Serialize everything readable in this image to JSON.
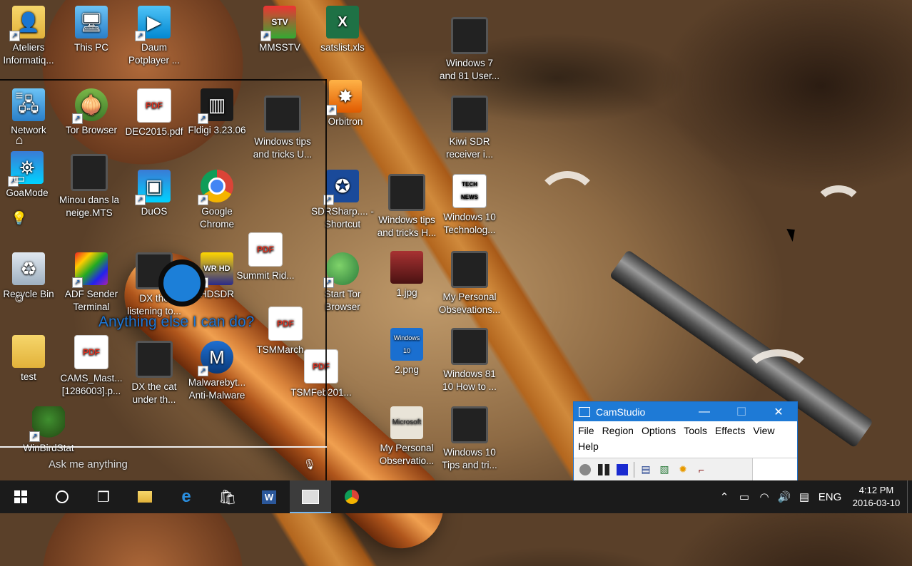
{
  "desktop": {
    "icons": [
      {
        "label": "Ateliers Informatiq...",
        "icon": "user-folder-icon"
      },
      {
        "label": "This PC",
        "icon": "computer-icon"
      },
      {
        "label": "Daum Potplayer ...",
        "icon": "play-icon"
      },
      {
        "label": "MMSSTV",
        "icon": "sstv-icon"
      },
      {
        "label": "satslist.xls",
        "icon": "excel-icon"
      },
      {
        "label": "Windows 7 and 81 User...",
        "icon": "video-icon"
      },
      {
        "label": "Network",
        "icon": "network-icon"
      },
      {
        "label": "Tor Browser",
        "icon": "tor-icon"
      },
      {
        "label": "DEC2015.pdf",
        "icon": "pdf-icon"
      },
      {
        "label": "Fldigi 3.23.06",
        "icon": "fldigi-icon"
      },
      {
        "label": "Windows tips and tricks U...",
        "icon": "video-icon"
      },
      {
        "label": "Orbitron",
        "icon": "orbitron-icon"
      },
      {
        "label": "Kiwi SDR receiver i...",
        "icon": "video-icon"
      },
      {
        "label": "GoaMode",
        "icon": "app-icon"
      },
      {
        "label": "Minou dans la neige.MTS",
        "icon": "video-icon"
      },
      {
        "label": "DuOS",
        "icon": "duos-icon"
      },
      {
        "label": "Google Chrome",
        "icon": "chrome-icon"
      },
      {
        "label": "SDRSharp.... - Shortcut",
        "icon": "sdrsharp-icon"
      },
      {
        "label": "Windows tips and tricks H...",
        "icon": "video-icon"
      },
      {
        "label": "Windows 10 Technolog...",
        "icon": "news-icon"
      },
      {
        "label": "Recycle Bin",
        "icon": "recycle-bin-icon"
      },
      {
        "label": "ADF Sender Terminal",
        "icon": "adf-icon"
      },
      {
        "label": "DX the listening to...",
        "icon": "video-icon"
      },
      {
        "label": "HDSDR",
        "icon": "hdsdr-icon"
      },
      {
        "label": "Summit Rid...",
        "icon": "pdf-icon"
      },
      {
        "label": "Start Tor Browser",
        "icon": "globe-icon"
      },
      {
        "label": "1.jpg",
        "icon": "image-icon"
      },
      {
        "label": "My Personal Obsevations...",
        "icon": "video-icon"
      },
      {
        "label": "test",
        "icon": "folder-icon"
      },
      {
        "label": "CAMS_Mast... [1286003].p...",
        "icon": "pdf-icon"
      },
      {
        "label": "DX the cat under th...",
        "icon": "video-icon"
      },
      {
        "label": "Malwarebyt... Anti-Malware",
        "icon": "malwarebytes-icon"
      },
      {
        "label": "TSMMarch....",
        "icon": "pdf-icon"
      },
      {
        "label": "TSMFeb201...",
        "icon": "pdf-icon"
      },
      {
        "label": "2.png",
        "icon": "image-icon"
      },
      {
        "label": "Windows 81 10 How to ...",
        "icon": "video-icon"
      },
      {
        "label": "WinBirdStat",
        "icon": "tree-icon"
      },
      {
        "label": "My Personal Observatio...",
        "icon": "video-icon"
      },
      {
        "label": "Windows 10 Tips and tri...",
        "icon": "video-icon"
      }
    ],
    "icon_badges": {
      "pdf": "PDF",
      "sstv": "STV",
      "excel": "X",
      "hdsdr": "WR HD",
      "tech": "TECH NEWS",
      "ms": "Microsoft",
      "win": "Windows 10"
    }
  },
  "cortana": {
    "prompt": "Anything else I can do?",
    "search_placeholder": "Ask me anything"
  },
  "camstudio": {
    "title": "CamStudio",
    "menu": [
      "File",
      "Region",
      "Options",
      "Tools",
      "Effects",
      "View",
      "Help"
    ],
    "controls": {
      "minimize": "—",
      "maximize": "☐",
      "close": "✕"
    }
  },
  "taskbar": {
    "pinned": [
      "start-icon",
      "cortana-icon",
      "task-view-icon",
      "file-explorer-icon",
      "edge-icon",
      "store-icon",
      "word-icon",
      "camstudio-icon",
      "chrome-icon"
    ],
    "language": "ENG",
    "time": "4:12 PM",
    "date": "2016-03-10"
  },
  "colors": {
    "accent": "#1e7ad6",
    "taskbar": "#1b1b1b",
    "cortana_text": "#1e78d8"
  }
}
